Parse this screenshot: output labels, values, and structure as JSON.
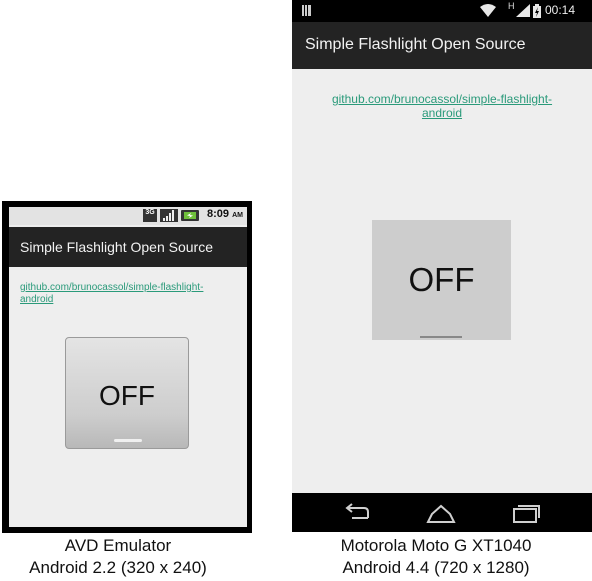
{
  "avd": {
    "status_time": "8:09",
    "status_ampm": "AM",
    "status_network": "3G",
    "app_title": "Simple Flashlight Open Source",
    "link_line1": "github.com/brunocassol/simple-flashlight-",
    "link_line2": "android",
    "button_label": "OFF",
    "caption_line1": "AVD Emulator",
    "caption_line2": "Android 2.2 (320 x 240)"
  },
  "moto": {
    "status_time": "00:14",
    "status_network": "H",
    "app_title": "Simple Flashlight Open Source",
    "link_line1": "github.com/brunocassol/simple-flashlight-",
    "link_line2": "android",
    "button_label": "OFF",
    "caption_line1": "Motorola Moto G XT1040",
    "caption_line2": "Android 4.4 (720 x 1280)"
  },
  "icons": {
    "back": "back-icon",
    "home": "home-icon",
    "recents": "recents-icon",
    "wifi": "wifi-icon",
    "signal": "signal-icon",
    "battery": "battery-icon",
    "notification": "notification-icon"
  },
  "colors": {
    "action_bar": "#232323",
    "screen_bg": "#eeeeee",
    "link": "#2a9a7a",
    "button_off": "#cdcdcd"
  }
}
